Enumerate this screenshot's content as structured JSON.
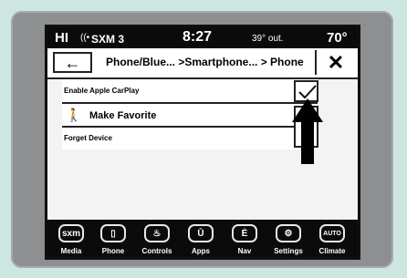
{
  "status": {
    "hvac": "HI",
    "radio": "SXM 3",
    "time": "8:27",
    "outside_temp": "39° out.",
    "set_temp": "70°"
  },
  "header": {
    "back_icon": "←",
    "breadcrumb": "Phone/Blue... >Smartphone... > Phone",
    "close_label": "✕"
  },
  "options": [
    {
      "label": "Enable Apple CarPlay",
      "checked": true
    },
    {
      "label": "Make Favorite",
      "icon": "favorite-person-icon",
      "checked": true
    },
    {
      "label": "Forget Device"
    }
  ],
  "dock": [
    {
      "icon": "sxm",
      "label": "Media"
    },
    {
      "icon": "▯",
      "label": "Phone"
    },
    {
      "icon": "♨",
      "label": "Controls"
    },
    {
      "icon": "Ū",
      "label": "Apps"
    },
    {
      "icon": "Ė",
      "label": "Nav"
    },
    {
      "icon": "⚙",
      "label": "Settings"
    },
    {
      "icon": "AUTO",
      "label": "Climate"
    }
  ],
  "colors": {
    "arrow": "#000000",
    "accent": "#0b0b0b",
    "surround": "#cde6e2"
  }
}
